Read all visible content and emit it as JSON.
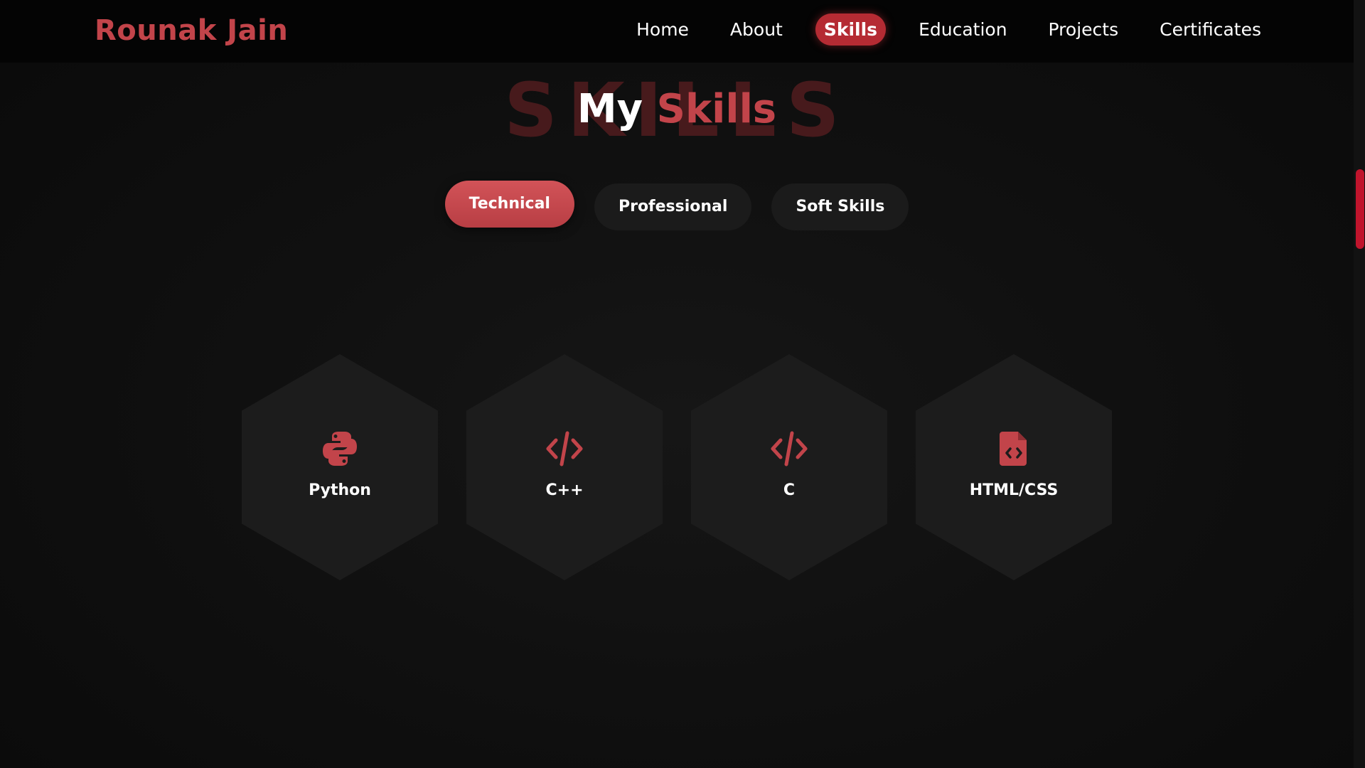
{
  "brand": "Rounak Jain",
  "nav": [
    {
      "label": "Home",
      "active": false
    },
    {
      "label": "About",
      "active": false
    },
    {
      "label": "Skills",
      "active": true
    },
    {
      "label": "Education",
      "active": false
    },
    {
      "label": "Projects",
      "active": false
    },
    {
      "label": "Certificates",
      "active": false
    }
  ],
  "heading": {
    "background_text": "SKILLS",
    "word1": "My",
    "word2": "Skills"
  },
  "tabs": [
    {
      "label": "Technical",
      "active": true
    },
    {
      "label": "Professional",
      "active": false
    },
    {
      "label": "Soft Skills",
      "active": false
    }
  ],
  "skills": [
    {
      "label": "Python",
      "icon": "python-icon"
    },
    {
      "label": "C++",
      "icon": "code-icon"
    },
    {
      "label": "C",
      "icon": "code-icon"
    },
    {
      "label": "HTML/CSS",
      "icon": "file-code-icon"
    }
  ],
  "colors": {
    "accent": "#c2444a",
    "nav_active": "#b52b33",
    "scroll_thumb": "#c0142c",
    "hex_bg": "#1c1c1c"
  }
}
